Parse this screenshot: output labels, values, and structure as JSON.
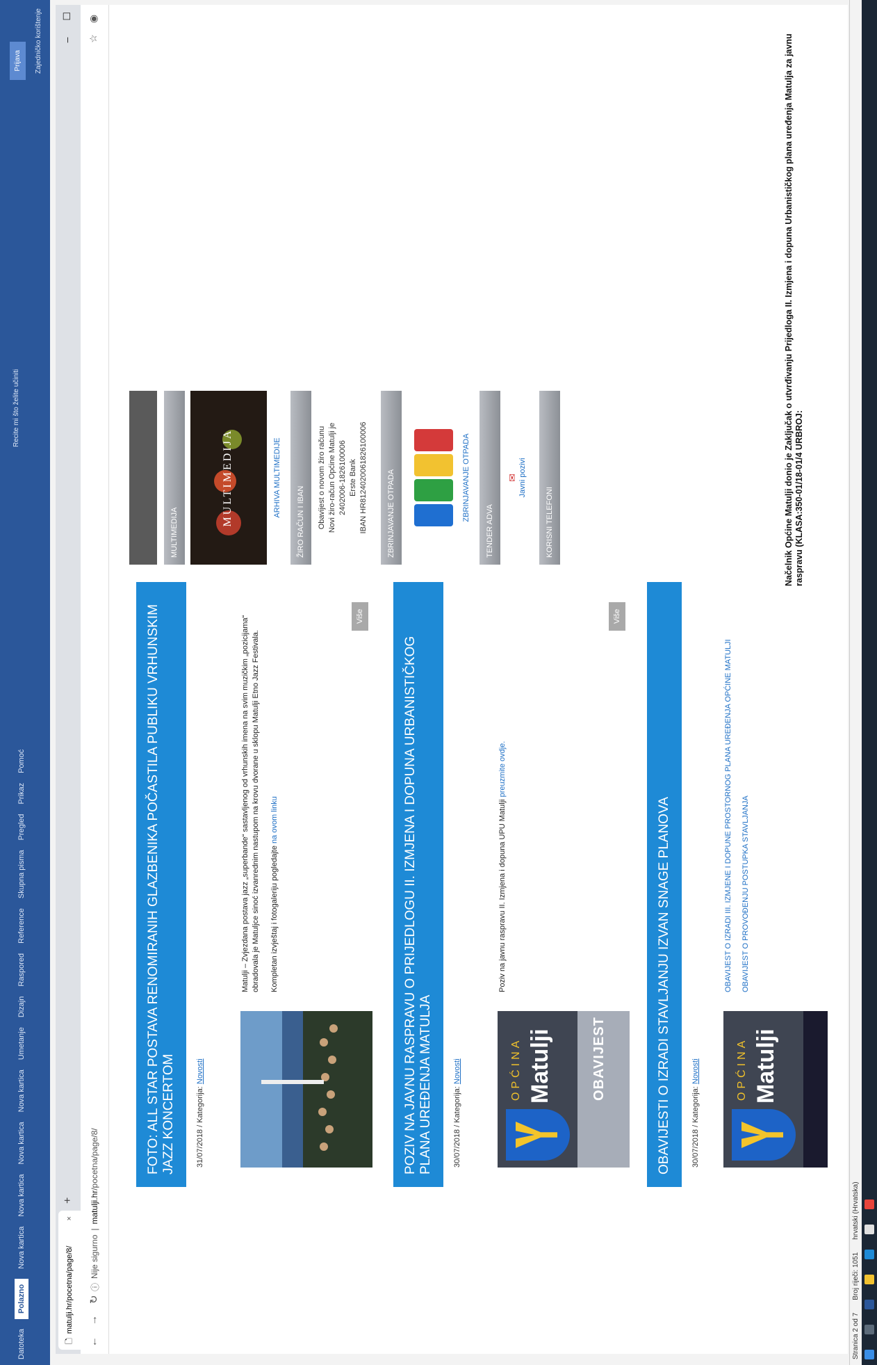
{
  "word": {
    "tabs": [
      "Datoteka",
      "Polazno",
      "Nova kartica",
      "Nova kartica",
      "Nova kartica",
      "Nova kartica",
      "Umetanje",
      "Dizajn",
      "Raspored",
      "Reference",
      "Skupna pisma",
      "Pregled",
      "Prikaz",
      "Pomoć"
    ],
    "active_tab": "Polazno",
    "tell_me": "Recite mi što želite učiniti",
    "sign_in": "Prijava",
    "share": "Zajedničko korištenje",
    "status_page": "Stranica 2 od 7",
    "status_words": "Broj riječi: 1051",
    "status_lang": "hrvatski (Hrvatska)",
    "notice_text": "Načelnik Općine Matulji donio je Zaključak o utvrđivanju Prijedloga II. Izmjena i dopuna Urbanističkog plana uređenja Matulja za javnu raspravu (KLASA:350-01/18-01/4 URBROJ:"
  },
  "browser": {
    "tab_title": "matulji.hr/pocetna/page/8/",
    "url_warning": "Nije sigurno",
    "url_domain": "matulji.hr",
    "url_path": "/pocetna/page/8/"
  },
  "posts": [
    {
      "title": "FOTO: ALL STAR POSTAVA RENOMIRANIH GLAZBENIKA POČASTILA PUBLIKU VRHUNSKIM JAZZ KONCERTOM",
      "date": "31/07/2018 / Kategorija:",
      "category": "Novosti",
      "excerpt": "Matulji – Zvjezdana postava jazz „superbande“ sastavljenog od vrhunskih imena na svim muzičkim „pozicijama“ obradovala je Matuljce sinoć izvanrednim nastupom na krovu dvorane u sklopu Matulji Etno Jazz Festivala.",
      "excerpt2": "Kompletan izvještaj i fotogaleriju pogledajte",
      "excerpt_link": "na ovom linku",
      "more": "Više"
    },
    {
      "title": "POZIV NA JAVNU RASPRAVU O PRIJEDLOGU II. IZMJENA I DOPUNA URBANISTIČKOG PLANA UREĐENJA MATULJA",
      "date": "30/07/2018 / Kategorija:",
      "category": "Novosti",
      "excerpt": "Poziv na javnu raspravu II. Izmjena i dopuna UPU Matulji",
      "excerpt_link": "preuzmite ovdje.",
      "more": "Više"
    },
    {
      "title": "OBAVIJESTI O IZRADI STAVLJANJU IZVAN SNAGE PLANOVA",
      "date": "30/07/2018 / Kategorija:",
      "category": "Novosti",
      "links": [
        "OBAVIJEST O IZRADI III. IZMJENE I DOPUNE PROSTORNOG PLANA UREĐENJA OPĆINE MATULJI",
        "OBAVIJEST O PROVOĐENJU POSTUPKA STAVLJANJA"
      ]
    }
  ],
  "obavijest_image": {
    "opcina": "OPĆINA",
    "matulji": "Matulji",
    "obavijest": "OBAVIJEST"
  },
  "sidebar": {
    "multimedija": "MULTIMEDIJA",
    "multimedija_img_text": "MULTIMEDIJA",
    "arhiva": "ARHIVA MULTIMEDIJE",
    "ziro": "ŽIRO RAČUN I IBAN",
    "ziro_text": [
      "Obavijest o novom žiro računu",
      "Novi žiro-račun Općine Matulji je",
      "2402006-1826100006",
      "Erste Bank",
      "IBAN HR8124020061826100006"
    ],
    "zbrinjavanje": "ZBRINJAVANJE OTPADA",
    "zbrinjavanje_link": "ZBRINJAVANJE OTPADA",
    "tender": "TENDER ADVA",
    "javni_pozivi": "Javni pozivi",
    "telefoni": "KORISNI TELEFONI"
  }
}
